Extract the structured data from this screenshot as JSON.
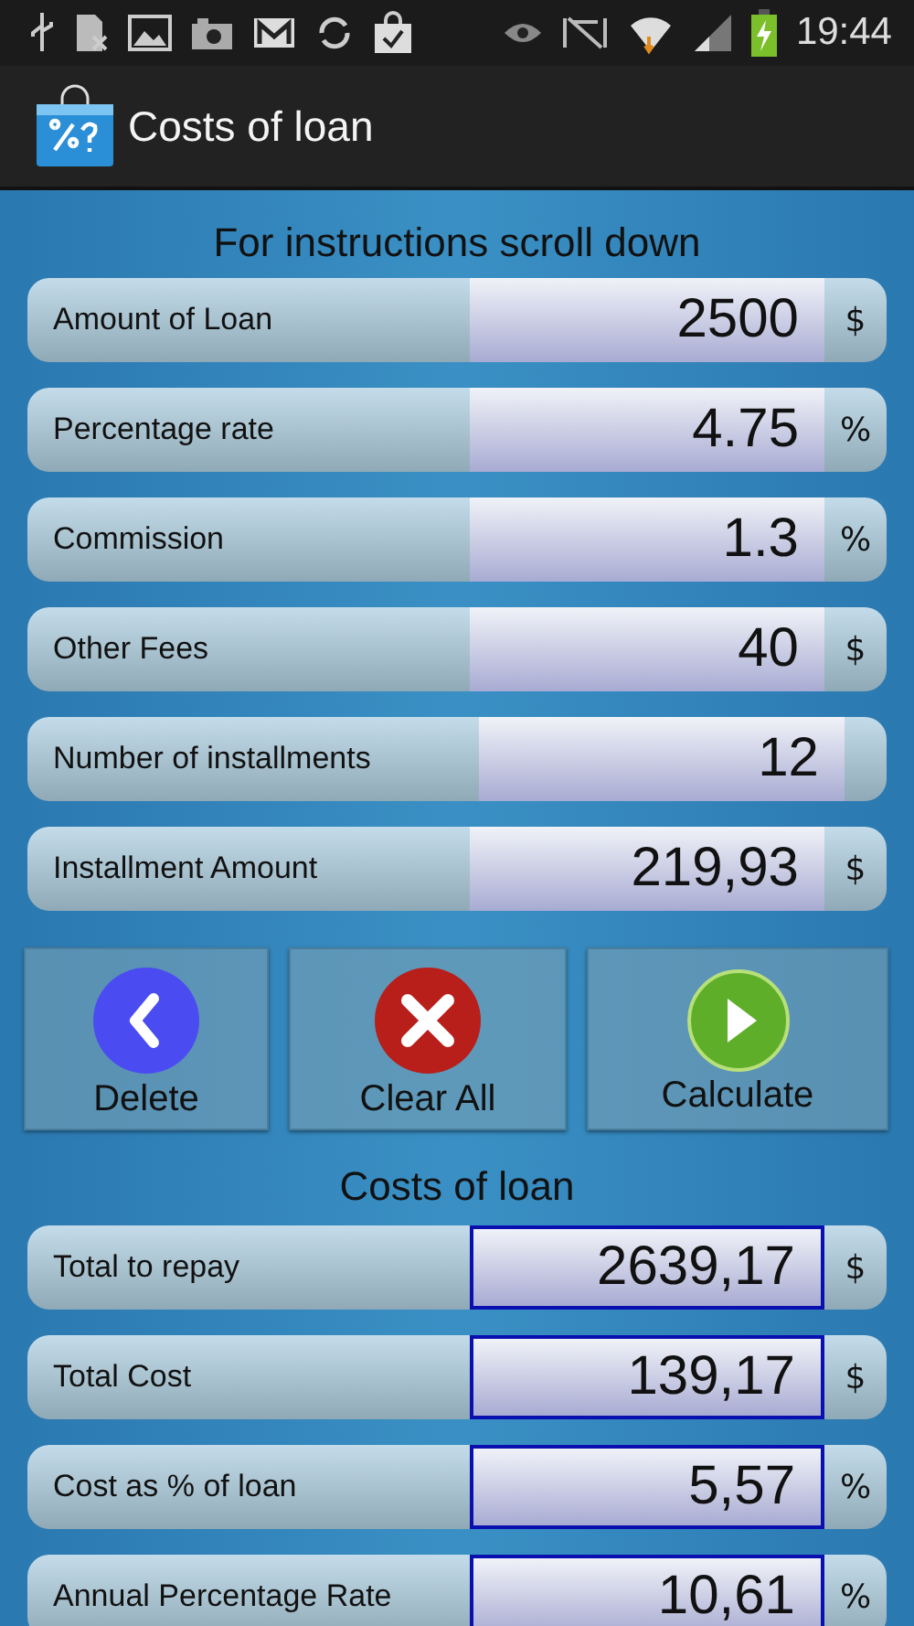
{
  "status_bar": {
    "time": "19:44"
  },
  "action_bar": {
    "title": "Costs of loan"
  },
  "inputs_heading": "For instructions scroll down",
  "inputs": [
    {
      "label": "Amount of Loan",
      "value": "2500",
      "unit": "$"
    },
    {
      "label": "Percentage rate",
      "value": "4.75",
      "unit": "%"
    },
    {
      "label": "Commission",
      "value": "1.3",
      "unit": "%"
    },
    {
      "label": "Other Fees",
      "value": "40",
      "unit": "$"
    },
    {
      "label": "Number of installments",
      "value": "12"
    },
    {
      "label": "Installment Amount",
      "value": "219,93",
      "unit": "$"
    }
  ],
  "buttons": [
    {
      "kind": "delete",
      "label": "Delete"
    },
    {
      "kind": "clear",
      "label": "Clear All"
    },
    {
      "kind": "calculate",
      "label": "Calculate"
    }
  ],
  "results_heading": "Costs of loan",
  "results": [
    {
      "label": "Total to repay",
      "value": "2639,17",
      "unit": "$"
    },
    {
      "label": "Total Cost",
      "value": "139,17",
      "unit": "$"
    },
    {
      "label": "Cost as % of loan",
      "value": "5,57",
      "unit": "%"
    },
    {
      "label": "Annual Percentage Rate",
      "value": "10,61",
      "unit": "%"
    }
  ]
}
